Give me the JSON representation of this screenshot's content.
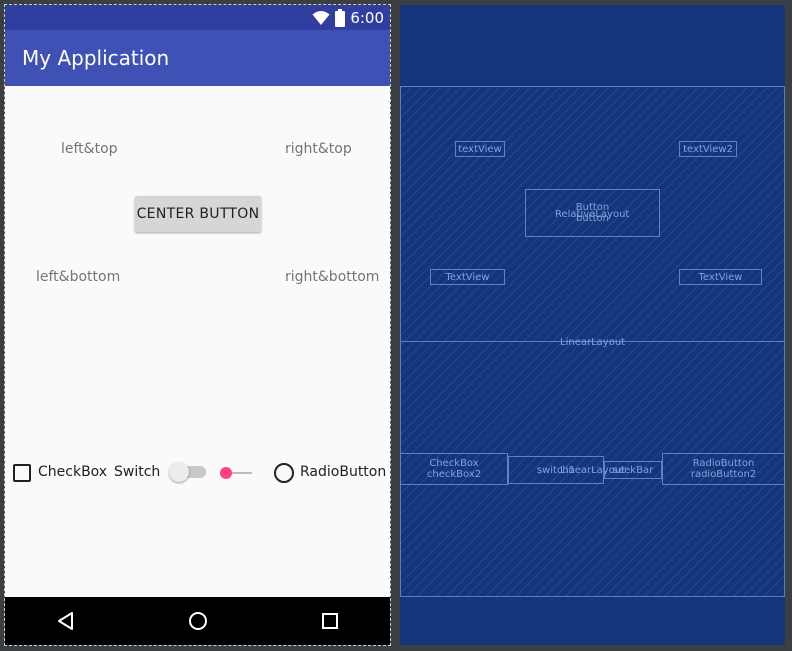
{
  "status_bar": {
    "time": "6:00",
    "icons": [
      "wifi-icon",
      "battery-icon"
    ]
  },
  "app_bar": {
    "title": "My Application"
  },
  "relative_layout": {
    "left_top": "left&top",
    "right_top": "right&top",
    "center_button": "CENTER BUTTON",
    "left_bottom": "left&bottom",
    "right_bottom": "right&bottom"
  },
  "linear_layout_row": {
    "checkbox_label": "CheckBox",
    "switch_label": "Switch",
    "radio_label": "RadioButton"
  },
  "nav_bar": {
    "icons": [
      "back-icon",
      "home-icon",
      "recents-icon"
    ]
  },
  "blueprint": {
    "text_view": "textView",
    "text_view2": "textView2",
    "button_line1": "Button",
    "button_line2": "button",
    "relative_layout": "RelativeLayout",
    "text_view_bottom_left": "TextView",
    "text_view_bottom_right": "TextView",
    "linear_layout_outer": "LinearLayout",
    "checkbox_line1": "CheckBox",
    "checkbox_line2": "checkBox2",
    "switch_id": "switch1",
    "linear_layout_inner": "LinearLayout",
    "seekbar_id": "seekBar",
    "radio_line1": "RadioButton",
    "radio_line2": "radioButton2"
  },
  "colors": {
    "primary": "#3f51b5",
    "primary_dark": "#303f9f",
    "accent": "#ff4081",
    "blueprint_bg": "#15357a"
  }
}
